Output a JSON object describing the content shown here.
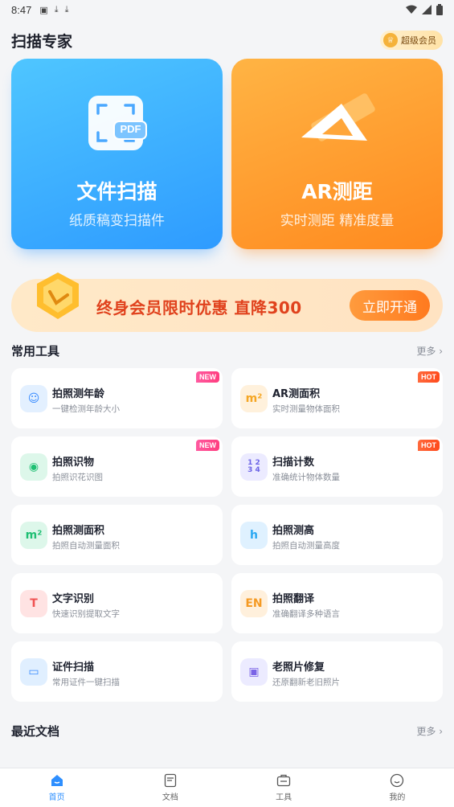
{
  "status_bar": {
    "time": "8:47",
    "icons": [
      "notification-a-icon",
      "download-icon",
      "download-icon"
    ],
    "right_icons": [
      "wifi-icon",
      "signal-icon",
      "battery-icon"
    ]
  },
  "header": {
    "title": "扫描专家",
    "vip_label": "超级会员"
  },
  "hero_cards": [
    {
      "title": "文件扫描",
      "subtitle": "纸质稿变扫描件",
      "icon_text": "PDF",
      "color": "#2e9bff"
    },
    {
      "title": "AR测距",
      "subtitle": "实时测距 精准度量",
      "color": "#ff8a1f"
    }
  ],
  "promo": {
    "text": "终身会员限时优惠 直降300",
    "button": "立即开通"
  },
  "common_tools": {
    "title": "常用工具",
    "more": "更多 ›",
    "items": [
      {
        "name": "拍照测年龄",
        "desc": "一键检测年龄大小",
        "tag": "NEW",
        "icon": "face-icon",
        "icon_text": "☺",
        "icon_bg": "#e3f0ff",
        "icon_color": "#3a8cff"
      },
      {
        "name": "AR测面积",
        "desc": "实时测量物体面积",
        "tag": "HOT",
        "icon": "cube-area-icon",
        "icon_text": "m²",
        "icon_bg": "#fff1dc",
        "icon_color": "#f5a623"
      },
      {
        "name": "拍照识物",
        "desc": "拍照识花识图",
        "tag": "NEW",
        "icon": "scan-object-icon",
        "icon_text": "◉",
        "icon_bg": "#ddf7ea",
        "icon_color": "#1fbf73"
      },
      {
        "name": "扫描计数",
        "desc": "准确统计物体数量",
        "tag": "HOT",
        "icon": "count-grid-icon",
        "icon_text": "1 2\n3 4",
        "icon_bg": "#ecebff",
        "icon_color": "#6b63e6"
      },
      {
        "name": "拍照测面积",
        "desc": "拍照自动测量面积",
        "tag": "",
        "icon": "area-measure-icon",
        "icon_text": "m²",
        "icon_bg": "#ddf7ea",
        "icon_color": "#1fbf73"
      },
      {
        "name": "拍照测高",
        "desc": "拍照自动测量高度",
        "tag": "",
        "icon": "height-measure-icon",
        "icon_text": "h",
        "icon_bg": "#dff1ff",
        "icon_color": "#2aa8f2"
      },
      {
        "name": "文字识别",
        "desc": "快速识别提取文字",
        "tag": "",
        "icon": "text-recognition-icon",
        "icon_text": "T",
        "icon_bg": "#ffe3e3",
        "icon_color": "#f05454"
      },
      {
        "name": "拍照翻译",
        "desc": "准确翻译多种语言",
        "tag": "",
        "icon": "translate-icon",
        "icon_text": "EN",
        "icon_bg": "#fff0dc",
        "icon_color": "#f59a23"
      },
      {
        "name": "证件扫描",
        "desc": "常用证件一键扫描",
        "tag": "",
        "icon": "id-card-icon",
        "icon_text": "▭",
        "icon_bg": "#e0efff",
        "icon_color": "#3a8cff"
      },
      {
        "name": "老照片修复",
        "desc": "还原翻新老旧照片",
        "tag": "",
        "icon": "photo-restore-icon",
        "icon_text": "▣",
        "icon_bg": "#ecebff",
        "icon_color": "#7a63e6"
      }
    ]
  },
  "recent_docs": {
    "title": "最近文档",
    "more": "更多 ›"
  },
  "bottom_nav": [
    {
      "label": "首页",
      "icon": "home-icon",
      "active": true
    },
    {
      "label": "文档",
      "icon": "document-icon",
      "active": false
    },
    {
      "label": "工具",
      "icon": "toolbox-icon",
      "active": false
    },
    {
      "label": "我的",
      "icon": "profile-icon",
      "active": false
    }
  ],
  "colors": {
    "accent": "#2e8fff",
    "promo_red": "#e0421d",
    "background": "#f4f5f7"
  }
}
